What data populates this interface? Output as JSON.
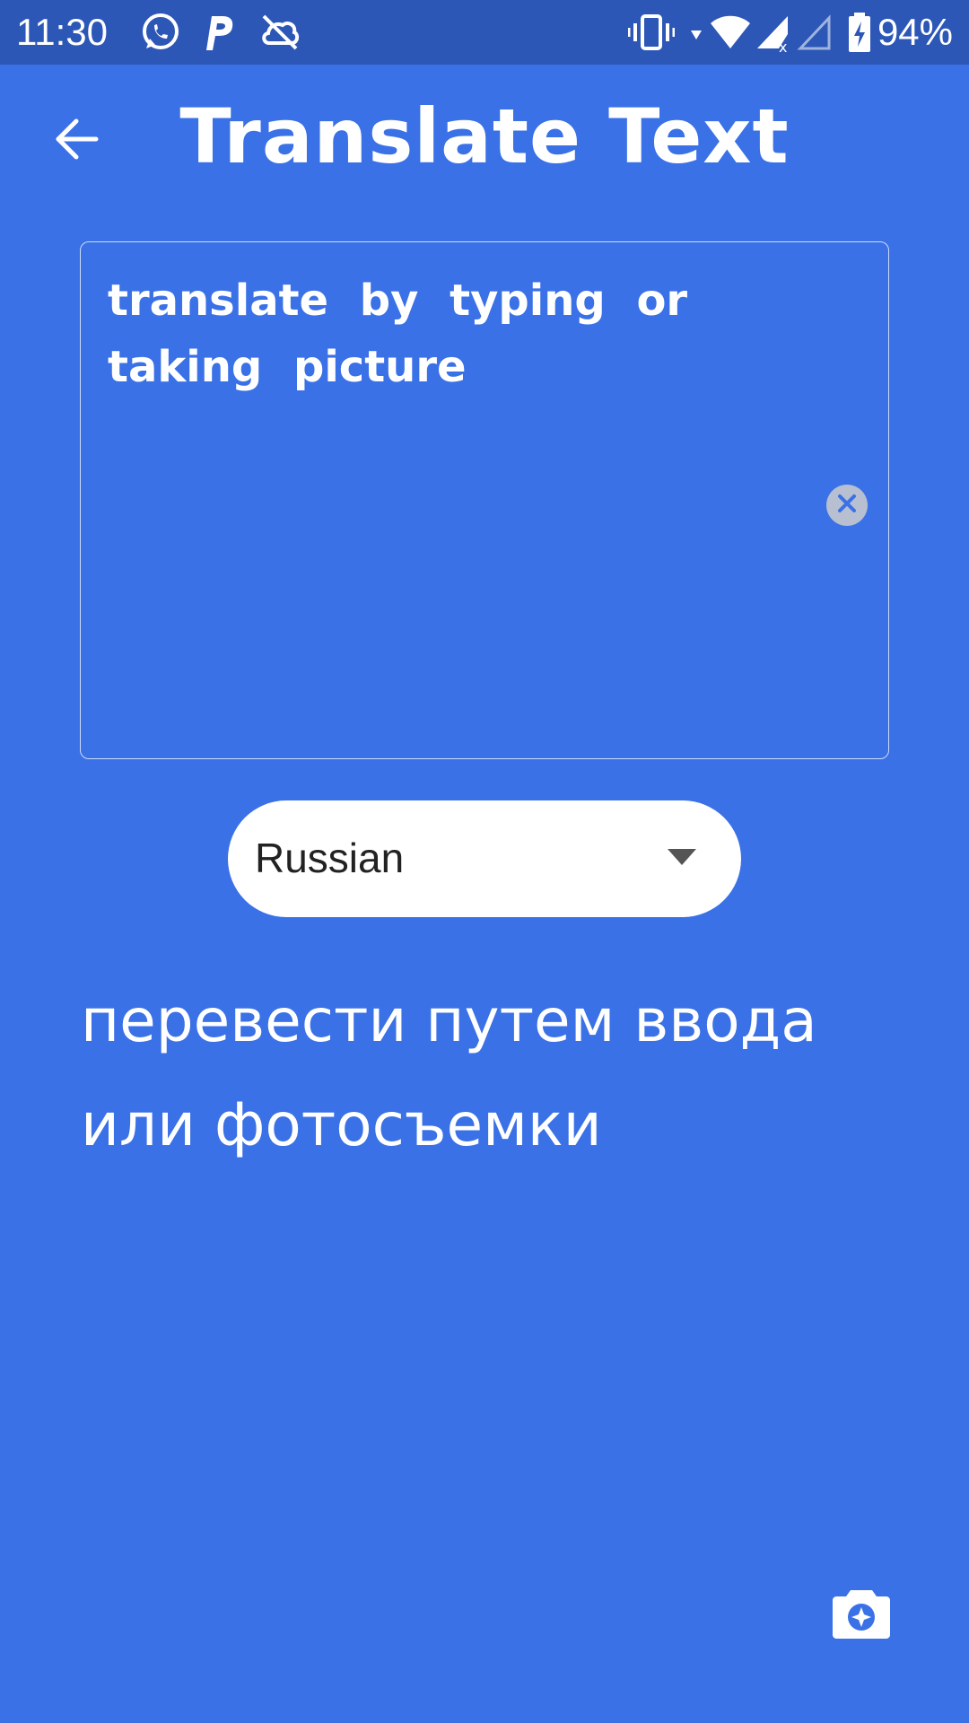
{
  "status_bar": {
    "time": "11:30",
    "battery_percent": "94%",
    "icons": [
      "whatsapp-icon",
      "parking-p-icon",
      "cloud-off-icon",
      "vibrate-icon",
      "wifi-icon",
      "signal-icon",
      "signal-empty-icon",
      "battery-charging-icon"
    ]
  },
  "app_bar": {
    "title": "Translate Text",
    "back_icon": "arrow-back-icon"
  },
  "input": {
    "value": "translate by typing or taking picture",
    "clear_icon": "clear-circle-icon"
  },
  "language_select": {
    "selected": "Russian",
    "caret_icon": "dropdown-caret-icon"
  },
  "output": {
    "text": "перевести путем ввода или фотосъемки"
  },
  "camera": {
    "icon": "camera-icon"
  },
  "colors": {
    "background": "#3a71e7",
    "status_bar": "#2c57b6",
    "text": "#ffffff",
    "select_background": "#ffffff"
  }
}
